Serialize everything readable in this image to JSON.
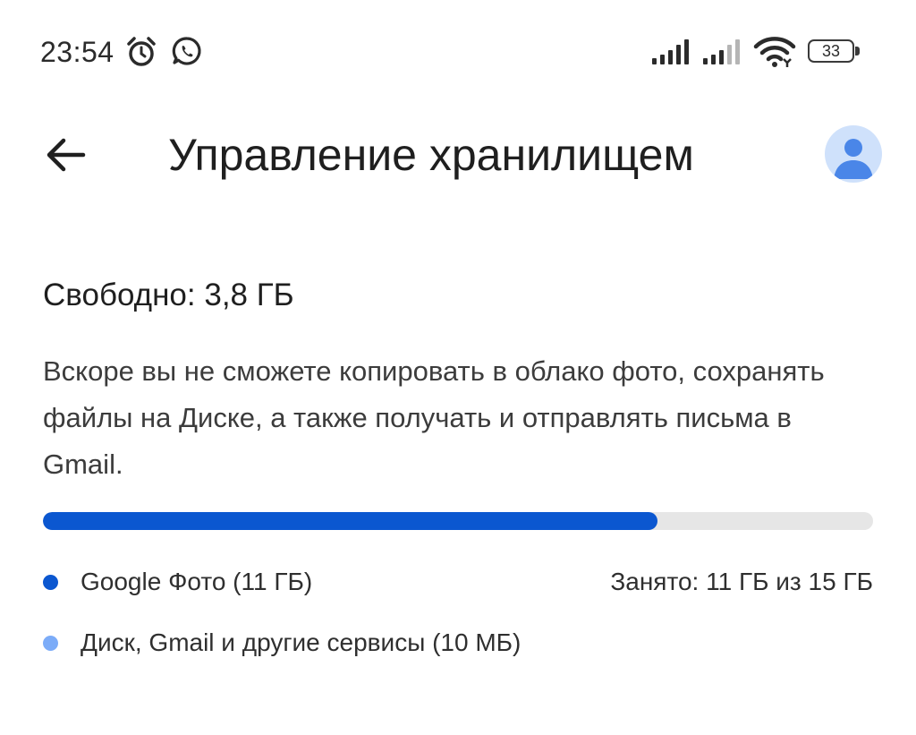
{
  "status_bar": {
    "time": "23:54",
    "battery_level": "33",
    "icons": [
      "alarm-icon",
      "whatsapp-icon",
      "signal-icon",
      "signal-icon",
      "wifi-icon",
      "battery-icon"
    ]
  },
  "app_bar": {
    "back_icon": "arrow-left-icon",
    "title": "Управление хранилищем",
    "avatar_icon": "account-icon"
  },
  "storage": {
    "free_heading": "Свободно: 3,8 ГБ",
    "warning": "Вскоре вы не сможете копировать в облако фото, сохранять файлы на Диске, а также получать и отправлять письма в Gmail.",
    "used_fraction": 0.74,
    "used_summary": "Занято: 11 ГБ из 15 ГБ",
    "legend": [
      {
        "label": "Google Фото (11 ГБ)",
        "color": "#0b57d0"
      },
      {
        "label": "Диск, Gmail и другие сервисы (10 МБ)",
        "color": "#7cacf8"
      }
    ]
  },
  "colors": {
    "accent": "#0b57d0",
    "accent_light": "#7cacf8",
    "track": "#e6e6e6",
    "avatar_bg": "#cfe1fb"
  }
}
